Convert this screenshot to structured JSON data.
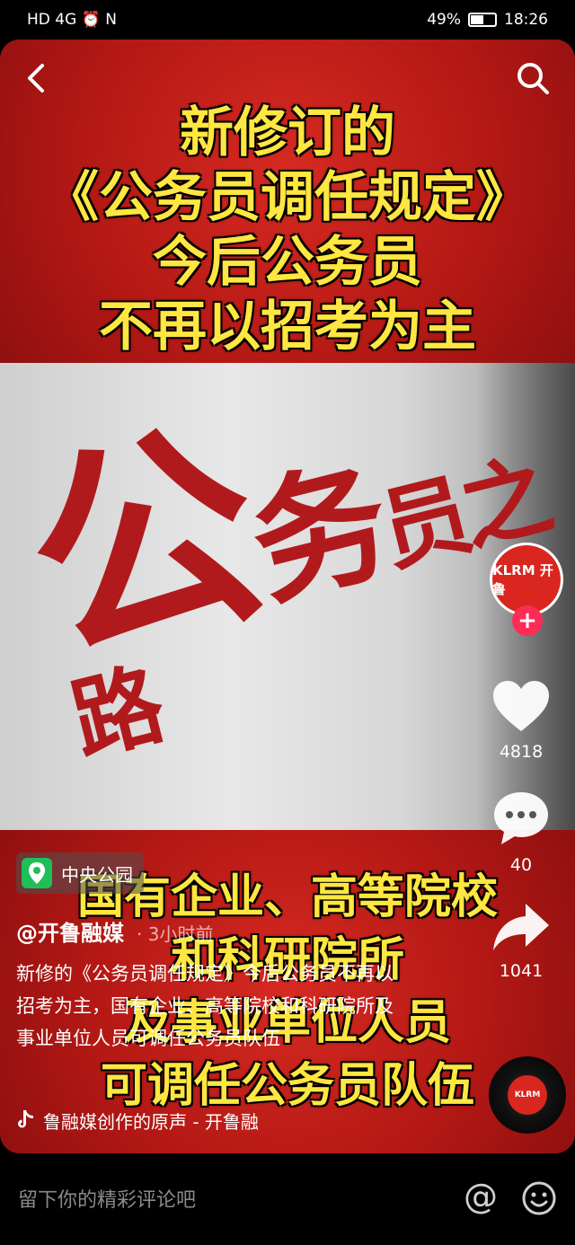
{
  "status": {
    "left_icons": "HD 4G ⏰ N",
    "battery_percent": "49%",
    "time": "18:26"
  },
  "video": {
    "headline_lines": [
      "新修订的",
      "《公务员调任规定》",
      "今后公务员",
      "不再以招考为主"
    ],
    "subline_lines": [
      "国有企业、高等院校",
      "和科研院所",
      "及事业单位人员",
      "可调任公务员队伍"
    ],
    "sign_text": {
      "big": "公",
      "mid": "务",
      "small": "员之路"
    }
  },
  "location": {
    "label": "中央公园",
    "icon": "location-pin-icon"
  },
  "author": {
    "handle": "@开鲁融媒",
    "time": "· 3小时前"
  },
  "description": "新修的《公务员调任规定》今后公务员不再以招考为主，国有企业、高等院校和科研院所及事业单位人员可调任公务员队伍",
  "music": {
    "text": "鲁融媒创作的原声 - 开鲁融",
    "icon": "tiktok-note-icon"
  },
  "rail": {
    "avatar_text": "KLRM 开鲁",
    "follow_symbol": "+",
    "likes": "4818",
    "comments": "40",
    "shares": "1041",
    "disc_text": "KLRM"
  },
  "comment_bar": {
    "placeholder": "留下你的精彩评论吧",
    "at_symbol": "@"
  },
  "colors": {
    "headline": "#ffe640",
    "follow": "#fe2c55",
    "location": "#1fbf58"
  }
}
